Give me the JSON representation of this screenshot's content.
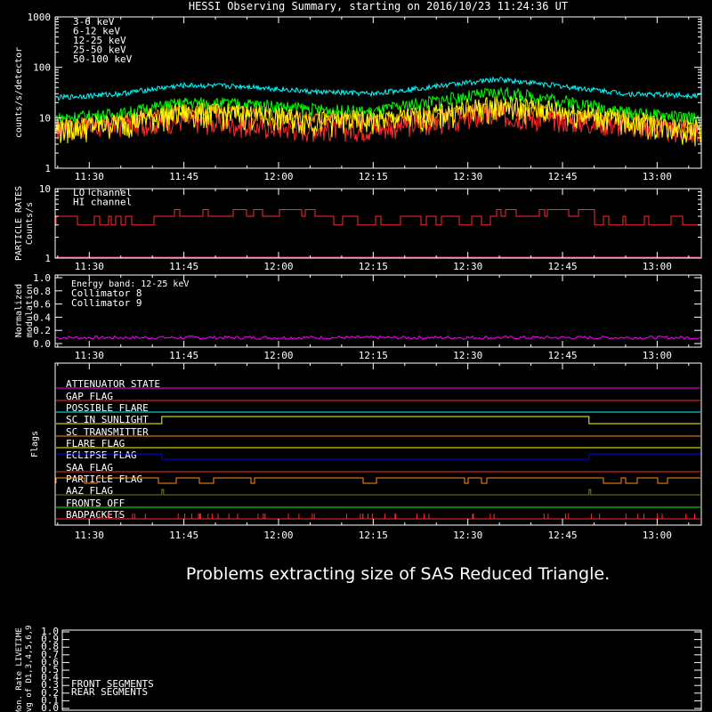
{
  "title": "HESSI Observing Summary, starting on 2016/10/23 11:24:36 UT",
  "time_ticks": [
    "11:30",
    "11:45",
    "12:00",
    "12:15",
    "12:30",
    "12:45",
    "13:00"
  ],
  "panels": {
    "counts": {
      "ylabel": "counts/s/detector",
      "ytick_labels": [
        "1",
        "10",
        "100",
        "1000"
      ],
      "legend": [
        {
          "label": "3-6 keV",
          "color": "#ff2a2a"
        },
        {
          "label": "6-12 keV",
          "color": "#ff8c1a"
        },
        {
          "label": "12-25 keV",
          "color": "#ffff00"
        },
        {
          "label": "25-50 keV",
          "color": "#00ff00"
        },
        {
          "label": "50-100 keV",
          "color": "#00ffff"
        }
      ]
    },
    "particle": {
      "ylabel_line1": "PARTICLE RATES",
      "ylabel_line2": "Counts/s",
      "ytick_labels": [
        "1",
        "10"
      ],
      "legend": [
        {
          "label": "LO channel",
          "color": "#ff2a2a"
        },
        {
          "label": "HI channel",
          "color": "#ff2a6a"
        }
      ]
    },
    "modulation": {
      "ylabel_line1": "Normalized",
      "ylabel_line2": "modulation",
      "ytick_labels": [
        "0.0",
        "0.2",
        "0.4",
        "0.6",
        "0.8",
        "1.0"
      ],
      "energy_band": "Energy band: 12-25 keV",
      "legend": [
        {
          "label": "Collimator 8",
          "color": "#00ffff"
        },
        {
          "label": "Collimator 9",
          "color": "#ff00ff"
        }
      ]
    },
    "flags": {
      "ylabel": "Flags",
      "items": [
        {
          "label": "ATTENUATOR STATE",
          "color": "#ff00ff"
        },
        {
          "label": "GAP FLAG",
          "color": "#ff2a2a"
        },
        {
          "label": "POSSIBLE FLARE",
          "color": "#00ffff"
        },
        {
          "label": "SC IN SUNLIGHT",
          "color": "#ffff00"
        },
        {
          "label": "SC TRANSMITTER",
          "color": "#ff8c1a"
        },
        {
          "label": "FLARE FLAG",
          "color": "#ffff00"
        },
        {
          "label": "ECLIPSE FLAG",
          "color": "#0000ff"
        },
        {
          "label": "SAA FLAG",
          "color": "#ff2a2a"
        },
        {
          "label": "PARTICLE FLAG",
          "color": "#ff8c1a"
        },
        {
          "label": "AAZ FLAG",
          "color": "#808000"
        },
        {
          "label": "FRONTS OFF",
          "color": "#00ff00"
        },
        {
          "label": "BADPACKETS",
          "color": "#ff2a2a"
        }
      ]
    },
    "livetime": {
      "ylabel_line1": "Mon. Rate LIVETIME",
      "ylabel_line2": "avg of D1,3,4,5,6,9",
      "ytick_labels": [
        "0.0",
        "0.1",
        "0.2",
        "0.3",
        "0.4",
        "0.5",
        "0.6",
        "0.7",
        "0.8",
        "0.9",
        "1.0"
      ],
      "legend": [
        {
          "label": "FRONT SEGMENTS",
          "color": "#00ff00"
        },
        {
          "label": "REAR SEGMENTS",
          "color": "#00a000"
        }
      ]
    }
  },
  "message": "Problems extracting size of SAS Reduced Triangle.",
  "chart_data": [
    {
      "type": "line",
      "title": "HESSI Observing Summary, starting on 2016/10/23 11:24:36 UT",
      "ylabel": "counts/s/detector",
      "yscale": "log",
      "ylim": [
        1,
        1000
      ],
      "x_unit": "UT",
      "xlim": [
        "11:24:36",
        "13:07:00"
      ],
      "x": [
        "11:25",
        "11:35",
        "11:45",
        "11:55",
        "12:05",
        "12:15",
        "12:25",
        "12:35",
        "12:45",
        "12:55",
        "13:05"
      ],
      "series": [
        {
          "name": "3-6 keV",
          "values": [
            6,
            7,
            9,
            7,
            6,
            6,
            8,
            11,
            9,
            7,
            5
          ]
        },
        {
          "name": "6-12 keV",
          "values": [
            7,
            9,
            14,
            13,
            10,
            9,
            11,
            16,
            12,
            9,
            7
          ]
        },
        {
          "name": "12-25 keV",
          "values": [
            6,
            8,
            13,
            12,
            9,
            9,
            12,
            18,
            14,
            9,
            6
          ]
        },
        {
          "name": "25-50 keV",
          "values": [
            10,
            12,
            20,
            19,
            15,
            13,
            22,
            32,
            22,
            13,
            10
          ]
        },
        {
          "name": "50-100 keV",
          "values": [
            25,
            30,
            44,
            42,
            33,
            30,
            42,
            58,
            42,
            30,
            28
          ]
        }
      ]
    },
    {
      "type": "line",
      "title": "PARTICLE RATES",
      "ylabel": "Counts/s",
      "yscale": "log",
      "ylim": [
        1,
        10
      ],
      "series": [
        {
          "name": "LO channel",
          "values_range": [
            3,
            5
          ]
        }
      ]
    },
    {
      "type": "line",
      "title": "Normalized modulation",
      "ylim": [
        0,
        1
      ],
      "series": [
        {
          "name": "Collimator 9",
          "values_approx": 0.1
        }
      ]
    }
  ]
}
